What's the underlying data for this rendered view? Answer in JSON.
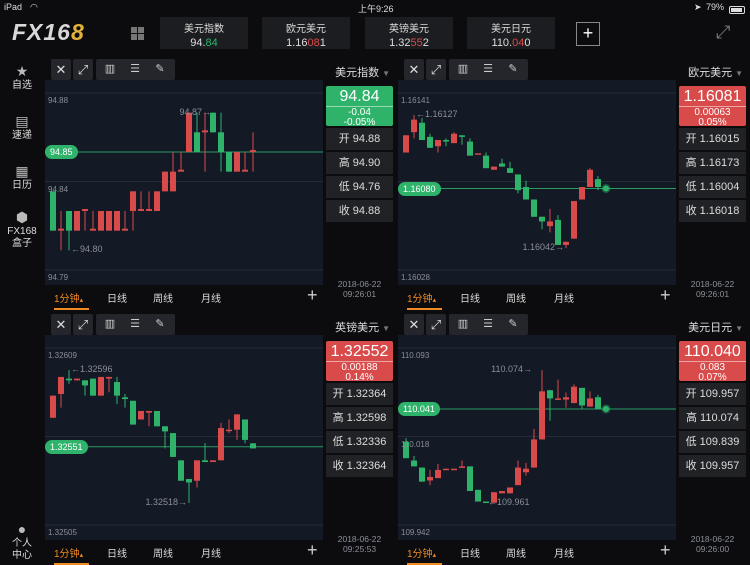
{
  "status": {
    "device": "iPad",
    "time": "上午9:26",
    "battery": "79%"
  },
  "header": {
    "logo": "FX16",
    "logo_accent": "8",
    "quotes": [
      {
        "name": "美元指数",
        "pre": "94.",
        "hl": "84",
        "post": "",
        "dir": "down"
      },
      {
        "name": "欧元美元",
        "pre": "1.16",
        "hl": "08",
        "post": "1",
        "dir": "up"
      },
      {
        "name": "英镑美元",
        "pre": "1.32",
        "hl": "55",
        "post": "2",
        "dir": "up"
      },
      {
        "name": "美元日元",
        "pre": "110.",
        "hl": "04",
        "post": "0",
        "dir": "up"
      }
    ],
    "add_label": "+"
  },
  "sidebar": {
    "items": [
      {
        "label": "自选",
        "icon": "star-icon",
        "glyph": "★"
      },
      {
        "label": "速递",
        "icon": "news-icon",
        "glyph": "▤"
      },
      {
        "label": "日历",
        "icon": "calendar-icon",
        "glyph": "▦"
      },
      {
        "label": "FX168\n盒子",
        "icon": "box-icon",
        "glyph": "⬢"
      },
      {
        "label": "个人\n中心",
        "icon": "user-icon",
        "glyph": "●"
      }
    ]
  },
  "colors": {
    "up": "#d94a4a",
    "down": "#2fb36b",
    "accent": "#f08a24"
  },
  "panels": [
    {
      "symbol": "美元指数",
      "price": "94.84",
      "change": "-0.04",
      "pct": "-0.05%",
      "dir": "down",
      "open": "开 94.88",
      "high": "高 94.90",
      "low": "低 94.76",
      "close": "收 94.88",
      "date": "2018-06-22",
      "time": "09:26:01",
      "current": "94.85",
      "current_value": 94.85,
      "dot": false,
      "grid": [
        "94.88",
        "94.84",
        "94.79"
      ],
      "ylim": [
        94.79,
        94.88
      ],
      "annotations": [
        {
          "text": "94.87→",
          "i": 20,
          "price": 94.87,
          "side": "left"
        },
        {
          "text": "←94.80",
          "i": 2,
          "price": 94.8,
          "side": "right"
        }
      ],
      "candles": [
        [
          94.83,
          94.83,
          94.81,
          94.81
        ],
        [
          94.81,
          94.82,
          94.8,
          94.811
        ],
        [
          94.82,
          94.82,
          94.8,
          94.81
        ],
        [
          94.81,
          94.82,
          94.81,
          94.82
        ],
        [
          94.82,
          94.82,
          94.81,
          94.821
        ],
        [
          94.81,
          94.82,
          94.81,
          94.811
        ],
        [
          94.81,
          94.82,
          94.81,
          94.82
        ],
        [
          94.81,
          94.82,
          94.81,
          94.82
        ],
        [
          94.81,
          94.82,
          94.81,
          94.82
        ],
        [
          94.81,
          94.82,
          94.81,
          94.811
        ],
        [
          94.82,
          94.83,
          94.81,
          94.83
        ],
        [
          94.82,
          94.83,
          94.82,
          94.821
        ],
        [
          94.82,
          94.83,
          94.82,
          94.821
        ],
        [
          94.82,
          94.83,
          94.82,
          94.83
        ],
        [
          94.83,
          94.84,
          94.83,
          94.84
        ],
        [
          94.83,
          94.85,
          94.83,
          94.84
        ],
        [
          94.84,
          94.85,
          94.84,
          94.841
        ],
        [
          94.85,
          94.87,
          94.85,
          94.87
        ],
        [
          94.86,
          94.87,
          94.85,
          94.85
        ],
        [
          94.86,
          94.87,
          94.84,
          94.861
        ],
        [
          94.87,
          94.87,
          94.86,
          94.86
        ],
        [
          94.86,
          94.87,
          94.84,
          94.85
        ],
        [
          94.85,
          94.85,
          94.84,
          94.84
        ],
        [
          94.84,
          94.85,
          94.84,
          94.85
        ],
        [
          94.84,
          94.85,
          94.84,
          94.841
        ],
        [
          94.85,
          94.86,
          94.84,
          94.851
        ]
      ]
    },
    {
      "symbol": "欧元美元",
      "price": "1.16081",
      "change": "0.00063",
      "pct": "0.05%",
      "dir": "up",
      "open": "开 1.16015",
      "high": "高 1.16173",
      "low": "低 1.16004",
      "close": "收 1.16018",
      "date": "2018-06-22",
      "time": "09:26:01",
      "current": "1.16080",
      "current_value": 1.1608,
      "dot": true,
      "grid": [
        "1.16141",
        "1.16086",
        "1.16028"
      ],
      "ylim": [
        1.16028,
        1.16141
      ],
      "annotations": [
        {
          "text": "←1.16127",
          "i": 1,
          "price": 1.16127,
          "side": "right"
        },
        {
          "text": "1.16042→",
          "i": 20,
          "price": 1.16042,
          "side": "left"
        }
      ],
      "candles": [
        [
          1.16103,
          1.16114,
          1.16103,
          1.16114
        ],
        [
          1.16116,
          1.16127,
          1.16112,
          1.16124
        ],
        [
          1.16122,
          1.16125,
          1.16111,
          1.16111
        ],
        [
          1.16113,
          1.16115,
          1.16106,
          1.16106
        ],
        [
          1.16107,
          1.16111,
          1.16103,
          1.16111
        ],
        [
          1.16111,
          1.16112,
          1.16107,
          1.1611
        ],
        [
          1.16109,
          1.16116,
          1.16109,
          1.16115
        ],
        [
          1.16114,
          1.16114,
          1.16108,
          1.16113
        ],
        [
          1.1611,
          1.16112,
          1.16101,
          1.16101
        ],
        [
          1.16102,
          1.16102,
          1.16102,
          1.161025
        ],
        [
          1.16101,
          1.16103,
          1.16093,
          1.16093
        ],
        [
          1.16092,
          1.16094,
          1.16092,
          1.16094
        ],
        [
          1.16096,
          1.16099,
          1.16094,
          1.16094
        ],
        [
          1.16093,
          1.16097,
          1.1609,
          1.1609
        ],
        [
          1.16089,
          1.16089,
          1.16077,
          1.16079
        ],
        [
          1.16081,
          1.16085,
          1.16073,
          1.16073
        ],
        [
          1.16073,
          1.16073,
          1.16062,
          1.16062
        ],
        [
          1.16062,
          1.16062,
          1.16054,
          1.16059
        ],
        [
          1.16056,
          1.16067,
          1.16052,
          1.16059
        ],
        [
          1.1606,
          1.16063,
          1.16044,
          1.16044
        ],
        [
          1.16044,
          1.16046,
          1.16042,
          1.16046
        ],
        [
          1.16048,
          1.16072,
          1.16048,
          1.16072
        ],
        [
          1.16073,
          1.16081,
          1.16073,
          1.16081
        ],
        [
          1.16081,
          1.16093,
          1.16081,
          1.16092
        ],
        [
          1.16086,
          1.16088,
          1.16079,
          1.16081
        ]
      ]
    },
    {
      "symbol": "英镑美元",
      "price": "1.32552",
      "change": "0.00188",
      "pct": "0.14%",
      "dir": "up",
      "open": "开 1.32364",
      "high": "高 1.32598",
      "low": "低 1.32336",
      "close": "收 1.32364",
      "date": "2018-06-22",
      "time": "09:25:53",
      "current": "1.32551",
      "current_value": 1.32551,
      "dot": false,
      "grid": [
        "1.32609",
        "1.32557",
        "1.32505"
      ],
      "ylim": [
        1.32505,
        1.32609
      ],
      "annotations": [
        {
          "text": "←1.32596",
          "i": 2,
          "price": 1.32596,
          "side": "right"
        },
        {
          "text": "1.32518→",
          "i": 17,
          "price": 1.32518,
          "side": "left"
        }
      ],
      "candles": [
        [
          1.32568,
          1.32581,
          1.32568,
          1.32581
        ],
        [
          1.32582,
          1.32592,
          1.32574,
          1.32592
        ],
        [
          1.32591,
          1.32596,
          1.32588,
          1.3259
        ],
        [
          1.3259,
          1.32591,
          1.3259,
          1.32591
        ],
        [
          1.3259,
          1.3259,
          1.32581,
          1.32587
        ],
        [
          1.32591,
          1.32591,
          1.32581,
          1.32581
        ],
        [
          1.32581,
          1.32592,
          1.32581,
          1.32592
        ],
        [
          1.32591,
          1.32592,
          1.32583,
          1.32592
        ],
        [
          1.32589,
          1.32592,
          1.32576,
          1.32581
        ],
        [
          1.3258,
          1.32582,
          1.32574,
          1.32579
        ],
        [
          1.32578,
          1.32578,
          1.32564,
          1.32564
        ],
        [
          1.32567,
          1.32572,
          1.32567,
          1.32572
        ],
        [
          1.32571,
          1.32572,
          1.32563,
          1.32572
        ],
        [
          1.32572,
          1.32572,
          1.32563,
          1.32563
        ],
        [
          1.32563,
          1.32563,
          1.3255,
          1.3256
        ],
        [
          1.32559,
          1.32559,
          1.32545,
          1.32545
        ],
        [
          1.32543,
          1.32543,
          1.32531,
          1.32531
        ],
        [
          1.32532,
          1.32532,
          1.32518,
          1.3253
        ],
        [
          1.32531,
          1.32543,
          1.32527,
          1.32543
        ],
        [
          1.32543,
          1.32553,
          1.32542,
          1.32542
        ],
        [
          1.32542,
          1.32543,
          1.32542,
          1.32543
        ],
        [
          1.32543,
          1.32565,
          1.32543,
          1.32562
        ],
        [
          1.32561,
          1.32567,
          1.32559,
          1.32561
        ],
        [
          1.32561,
          1.3257,
          1.32555,
          1.3257
        ],
        [
          1.32567,
          1.32567,
          1.32553,
          1.32555
        ],
        [
          1.32553,
          1.32553,
          1.3255,
          1.3255
        ]
      ]
    },
    {
      "symbol": "美元日元",
      "price": "110.040",
      "change": "0.083",
      "pct": "0.07%",
      "dir": "up",
      "open": "开 109.957",
      "high": "高 110.074",
      "low": "低 109.839",
      "close": "收 109.957",
      "date": "2018-06-22",
      "time": "09:26:00",
      "current": "110.041",
      "current_value": 110.041,
      "dot": true,
      "grid": [
        "110.093",
        "110.018",
        "109.942"
      ],
      "ylim": [
        109.942,
        110.093
      ],
      "annotations": [
        {
          "text": "110.074→",
          "i": 16,
          "price": 110.074,
          "side": "left"
        },
        {
          "text": "←109.961",
          "i": 10,
          "price": 109.961,
          "side": "right"
        }
      ],
      "candles": [
        [
          110.013,
          110.016,
          109.999,
          109.999
        ],
        [
          109.997,
          110.001,
          109.992,
          109.992
        ],
        [
          109.991,
          109.991,
          109.979,
          109.979
        ],
        [
          109.98,
          109.989,
          109.976,
          109.983
        ],
        [
          109.982,
          109.994,
          109.982,
          109.989
        ],
        [
          109.989,
          109.99,
          109.989,
          109.99
        ],
        [
          109.989,
          109.99,
          109.989,
          109.99
        ],
        [
          109.991,
          109.997,
          109.991,
          109.992
        ],
        [
          109.992,
          109.992,
          109.971,
          109.971
        ],
        [
          109.972,
          109.972,
          109.962,
          109.962
        ],
        [
          109.962,
          109.962,
          109.961,
          109.961
        ],
        [
          109.961,
          109.97,
          109.961,
          109.97
        ],
        [
          109.969,
          109.971,
          109.969,
          109.971
        ],
        [
          109.969,
          109.974,
          109.969,
          109.974
        ],
        [
          109.976,
          109.997,
          109.976,
          109.991
        ],
        [
          109.987,
          109.995,
          109.984,
          109.99
        ],
        [
          109.991,
          110.024,
          109.991,
          110.015
        ],
        [
          110.015,
          110.074,
          110.015,
          110.056
        ],
        [
          110.057,
          110.057,
          110.031,
          110.05
        ],
        [
          110.049,
          110.066,
          110.049,
          110.05
        ],
        [
          110.049,
          110.055,
          110.042,
          110.051
        ],
        [
          110.046,
          110.062,
          110.046,
          110.06
        ],
        [
          110.059,
          110.059,
          110.041,
          110.044
        ],
        [
          110.043,
          110.056,
          110.043,
          110.05
        ],
        [
          110.051,
          110.053,
          110.041,
          110.041
        ]
      ]
    }
  ],
  "panel_ui": {
    "tabs": [
      "1分钟",
      "日线",
      "周线",
      "月线"
    ],
    "tab_caret": "▴",
    "add": "+",
    "close_glyph": "✕",
    "expand_glyph": "⤢",
    "tools": [
      "▥",
      "☰",
      "✎"
    ]
  }
}
